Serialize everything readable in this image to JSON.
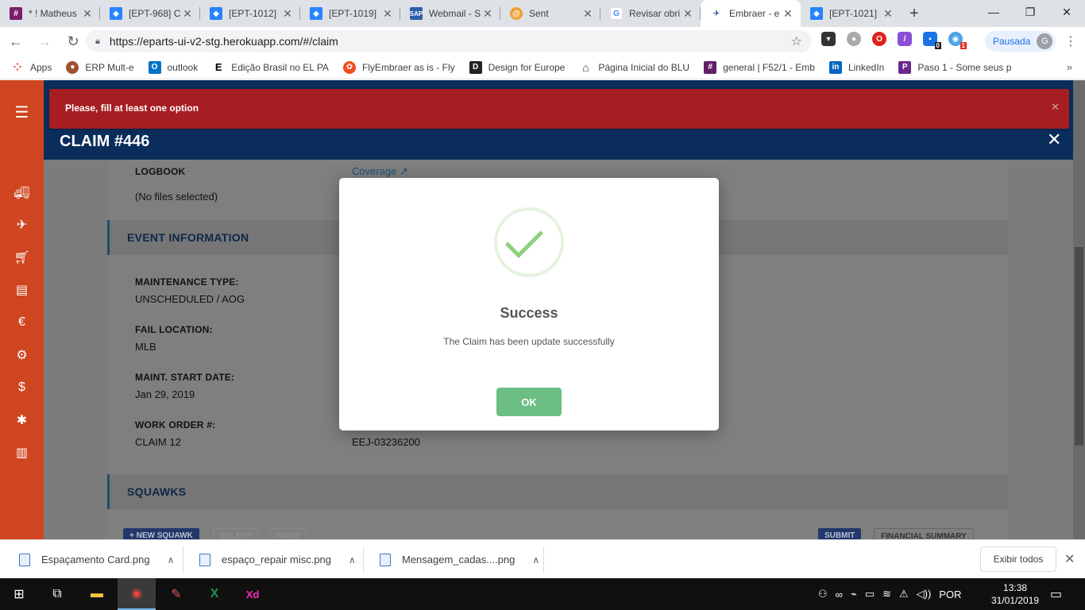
{
  "browser": {
    "tabs": [
      {
        "title": "* ! Matheus",
        "fav": "#"
      },
      {
        "title": "[EPT-968] C",
        "fav": "J"
      },
      {
        "title": "[EPT-1012]",
        "fav": "J"
      },
      {
        "title": "[EPT-1019]",
        "fav": "J"
      },
      {
        "title": "Webmail - S",
        "fav": "W"
      },
      {
        "title": "Sent",
        "fav": "S"
      },
      {
        "title": "Revisar obri",
        "fav": "G"
      },
      {
        "title": "Embraer - e",
        "fav": "E"
      },
      {
        "title": "[EPT-1021]",
        "fav": "J"
      }
    ],
    "active_tab_index": 7,
    "url": "https://eparts-ui-v2-stg.herokuapp.com/#/claim",
    "profile_label": "Pausada",
    "profile_initial": "G",
    "ext_badges": [
      "0",
      "1"
    ],
    "bookmarks": [
      {
        "label": "Apps",
        "icon": "apps-grid-icon"
      },
      {
        "label": "ERP Mult-e",
        "icon": "erp-icon"
      },
      {
        "label": "outlook",
        "icon": "outlook-icon"
      },
      {
        "label": "Edição Brasil no EL PA",
        "icon": "elpais-icon"
      },
      {
        "label": "FlyEmbraer as is - Fly",
        "icon": "figma-icon"
      },
      {
        "label": "Design for Europe",
        "icon": "d-icon"
      },
      {
        "label": "Página Inicial do BLU",
        "icon": "home-icon"
      },
      {
        "label": "general | F52/1 - Emb",
        "icon": "slack-icon"
      },
      {
        "label": "LinkedIn",
        "icon": "linkedin-icon"
      },
      {
        "label": "Paso 1 - Some seus p",
        "icon": "paso-icon"
      }
    ]
  },
  "app": {
    "alert_text": "Please, fill at least one option",
    "claim_title": "CLAIM #446",
    "logbook_label": "LOGBOOK",
    "logbook_value": "(No files selected)",
    "coverage_link": "Coverage",
    "event_section_title": "EVENT INFORMATION",
    "fields": [
      {
        "label": "MAINTENANCE TYPE:",
        "value": "UNSCHEDULED / AOG"
      },
      {
        "label": "FAIL LOCATION:",
        "value": "MLB"
      },
      {
        "label": "MAINT. START DATE:",
        "value": "Jan 29, 2019"
      },
      {
        "label": "WORK ORDER #:",
        "value": "CLAIM 12"
      }
    ],
    "work_order_right_value": "EEJ-03236200",
    "squawks_title": "SQUAWKS",
    "buttons": {
      "new_squawk": "+ NEW SQUAWK",
      "delete": "DELETE",
      "print": "PRINT",
      "submit": "SUBMIT",
      "financial_summary": "FINANCIAL SUMMARY"
    }
  },
  "modal": {
    "title": "Success",
    "message": "The Claim has been update successfully",
    "ok_label": "OK",
    "accent": "#8bd17c",
    "button_color": "#6cbf84"
  },
  "downloads": {
    "items": [
      "Espaçamento Card.png",
      "espaço_repair misc.png",
      "Mensagem_cadas....png"
    ],
    "show_all": "Exibir todos"
  },
  "taskbar": {
    "language": "POR",
    "time": "13:38",
    "date": "31/01/2019"
  },
  "colors": {
    "sidebar": "#cf4520",
    "header": "#0b2d5c",
    "alert": "#a61d22"
  }
}
